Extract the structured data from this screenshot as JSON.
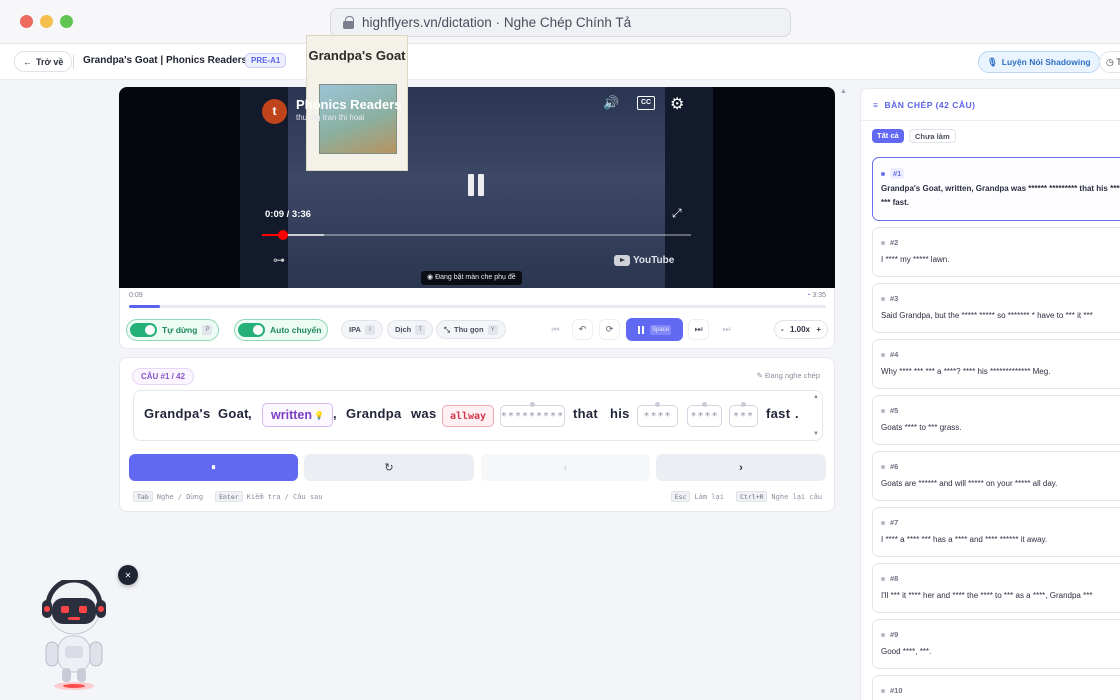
{
  "browser": {
    "url": "highflyers.vn/dictation · Nghe Chép Chính Tả",
    "traffic_colors": [
      "#ed6a5e",
      "#f5bf4f",
      "#61c554"
    ]
  },
  "header": {
    "back_label": "Trở về",
    "lesson_title": "Grandpa's Goat | Phonics Readers",
    "level": "PRE-A1",
    "shadowing_label": "Luyện Nói Shadowing",
    "more_label": "T"
  },
  "video": {
    "title": "Phonics Readers",
    "channel": "thuong tran thi hoai",
    "avatar_letter": "t",
    "book_title": "Grandpa's Goat",
    "time": "0:09 / 3:36",
    "progress_fraction": 0.049,
    "buffer_fraction": 0.145,
    "caption": "Đang bật màn che phụ đề",
    "youtube_label": "YouTube",
    "cc_label": "CC"
  },
  "player": {
    "current_time": "0:09",
    "total_time": "3:35",
    "progress_fraction": 0.044,
    "auto_pause_label": "Tự dừng",
    "auto_pause_key": "P",
    "auto_next_label": "Auto chuyển",
    "ipa_label": "IPA",
    "ipa_key": "I",
    "translate_label": "Dịch",
    "translate_key": "T",
    "collapse_label": "Thu gọn",
    "collapse_key": "Y",
    "play_key": "Space",
    "speed": "1.00x",
    "speed_minus": "-",
    "speed_plus": "+"
  },
  "dictation": {
    "sentence_label": "CÂU #1 / 42",
    "listen_label": "Đang nghe chép",
    "tokens": {
      "w1": "Grandpa's",
      "w2": "Goat",
      "p1": ",",
      "typed": "written",
      "p2": ",",
      "w3": "Grandpa",
      "w4": "was",
      "wrong": "allway",
      "blank1": "*********",
      "w5": "that",
      "w6": "his",
      "blank2": "****",
      "blank3": "****",
      "blank4": "***",
      "w7": "fast",
      "p3": "."
    },
    "hints": {
      "tab_key": "Tab",
      "tab_text": "Nghe / Dừng",
      "enter_key": "Enter",
      "enter_text": "Kiểm tra / Câu sau",
      "esc_key": "Esc",
      "esc_text": "Làm lại",
      "ctrlr_key": "Ctrl+R",
      "ctrlr_text": "Nghe lại câu"
    }
  },
  "transcript": {
    "title": "BÀN CHÉP (42 CÂU)",
    "tab_all": "Tất cả",
    "tab_todo": "Chưa làm",
    "items": [
      {
        "num": "#1",
        "text": "Grandpa's Goat, written, Grandpa was ****** ********* that his **** *** fast."
      },
      {
        "num": "#2",
        "text": "I **** my ***** lawn."
      },
      {
        "num": "#3",
        "text": "Said Grandpa, but the ***** ***** so ******* * have to *** it ***"
      },
      {
        "num": "#4",
        "text": "Why **** *** *** a ****? **** his ************* Meg."
      },
      {
        "num": "#5",
        "text": "Goats **** to *** grass."
      },
      {
        "num": "#6",
        "text": "Goats are ****** and will ***** on your ***** all day."
      },
      {
        "num": "#7",
        "text": "I **** a **** *** has a **** and **** ****** it away."
      },
      {
        "num": "#8",
        "text": "I'll *** it **** her and **** the **** to *** as a ****, Grandpa ***"
      },
      {
        "num": "#9",
        "text": "Good ****, ***."
      },
      {
        "num": "#10",
        "text": ""
      }
    ]
  },
  "colors": {
    "accent": "#6168f2",
    "toggle_on": "#25b07a",
    "wrong": "#d03a4d",
    "typed": "#7b3fc0"
  }
}
